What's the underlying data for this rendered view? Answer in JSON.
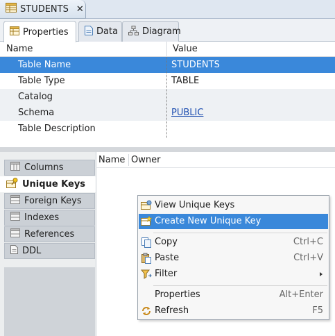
{
  "editor": {
    "tab_title": "STUDENTS"
  },
  "subtabs": [
    {
      "label": "Properties",
      "active": true
    },
    {
      "label": "Data"
    },
    {
      "label": "Diagram"
    }
  ],
  "properties": {
    "headers": {
      "name": "Name",
      "value": "Value"
    },
    "rows": [
      {
        "name": "Table Name",
        "value": "STUDENTS",
        "selected": true
      },
      {
        "name": "Table Type",
        "value": "TABLE"
      },
      {
        "name": "Catalog",
        "value": ""
      },
      {
        "name": "Schema",
        "value": "PUBLIC",
        "link": true
      },
      {
        "name": "Table Description",
        "value": ""
      }
    ]
  },
  "side_tabs": [
    {
      "label": "Columns"
    },
    {
      "label": "Unique Keys",
      "active": true
    },
    {
      "label": "Foreign Keys"
    },
    {
      "label": "Indexes"
    },
    {
      "label": "References"
    },
    {
      "label": "DDL"
    }
  ],
  "unique_keys_table": {
    "headers": [
      "Name",
      "Owner"
    ]
  },
  "context_menu": {
    "items": [
      {
        "label": "View Unique Keys",
        "icon": "view-keys-icon"
      },
      {
        "label": "Create New Unique Key",
        "icon": "create-key-icon",
        "highlighted": true
      },
      {
        "separator": true
      },
      {
        "label": "Copy",
        "shortcut": "Ctrl+C",
        "icon": "copy-icon"
      },
      {
        "label": "Paste",
        "shortcut": "Ctrl+V",
        "icon": "paste-icon"
      },
      {
        "label": "Filter",
        "submenu": true,
        "icon": "filter-icon"
      },
      {
        "separator": true
      },
      {
        "label": "Properties",
        "shortcut": "Alt+Enter"
      },
      {
        "label": "Refresh",
        "shortcut": "F5",
        "icon": "refresh-icon"
      }
    ]
  },
  "colors": {
    "selection": "#3a88da",
    "link": "#1d4eb0"
  }
}
